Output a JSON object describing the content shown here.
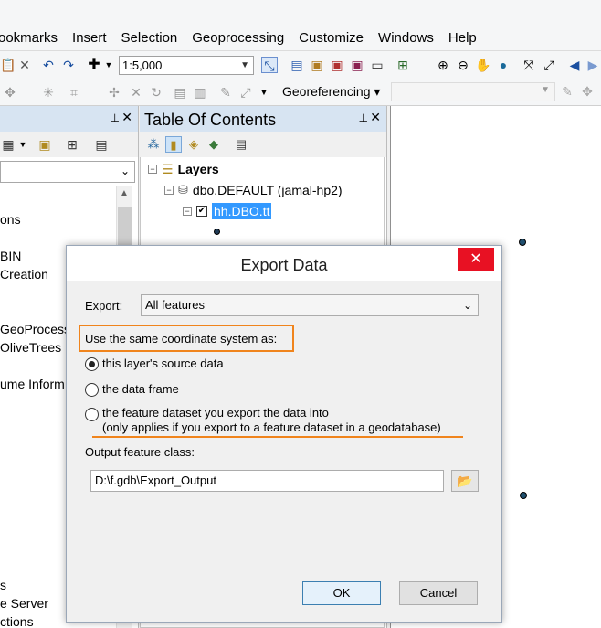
{
  "menubar": {
    "items": [
      "ookmarks",
      "Insert",
      "Selection",
      "Geoprocessing",
      "Customize",
      "Windows",
      "Help"
    ]
  },
  "toolbar": {
    "scale_value": "1:5,000",
    "georeferencing_label": "Georeferencing ▾"
  },
  "catalog": {
    "items": [
      "ons",
      "BIN",
      "Creation",
      "GeoProcess",
      "OliveTrees",
      "ume Inform",
      "s",
      "e Server",
      "ctions"
    ]
  },
  "toc": {
    "title": "Table Of Contents",
    "layers_label": "Layers",
    "connection_label": "dbo.DEFAULT (jamal-hp2)",
    "layer_label": "hh.DBO.tt"
  },
  "dialog": {
    "title": "Export Data",
    "export_label": "Export:",
    "export_value": "All features",
    "coord_label": "Use the same coordinate system as:",
    "radio_source": "this layer's source data",
    "radio_frame": "the data frame",
    "radio_dataset": "the feature dataset you export the data into",
    "radio_dataset_note": "(only applies if you export to a feature dataset in a geodatabase)",
    "output_label": "Output feature class:",
    "output_value": "D:\\f.gdb\\Export_Output",
    "ok_label": "OK",
    "cancel_label": "Cancel"
  },
  "colors": {
    "highlight_orange": "#f0841c",
    "close_red": "#e81123",
    "selection_blue": "#3399ff",
    "pane_header": "#d7e4f2"
  },
  "icons": [
    "paste-icon",
    "delete-icon",
    "undo-icon",
    "redo-icon",
    "add-data-icon",
    "zoom-in-icon",
    "zoom-out-icon",
    "pan-icon",
    "globe-icon",
    "back-icon",
    "pin-icon",
    "close-icon",
    "layers-icon",
    "database-icon",
    "folder-open-icon"
  ]
}
